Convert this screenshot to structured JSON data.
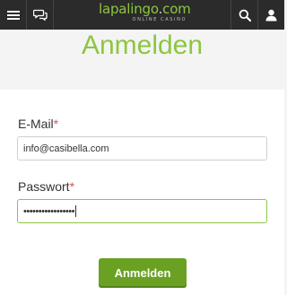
{
  "header": {
    "brand": {
      "name": "lapalingo",
      "dot": ".",
      "tld": "com",
      "tagline": "ONLINE CASINO"
    },
    "icons": [
      "menu-icon",
      "chat-icon",
      "search-icon",
      "user-icon"
    ]
  },
  "page": {
    "title": "Anmelden"
  },
  "form": {
    "email": {
      "label": "E-Mail",
      "required_mark": "*",
      "value": "info@casibella.com"
    },
    "password": {
      "label": "Passwort",
      "required_mark": "*",
      "value": "•••••••••••••••••"
    },
    "submit_label": "Anmelden"
  },
  "colors": {
    "accent": "#8dc63f",
    "button": "#6aa122",
    "header_bg": "#2b2b2b",
    "required": "#d9534f"
  }
}
